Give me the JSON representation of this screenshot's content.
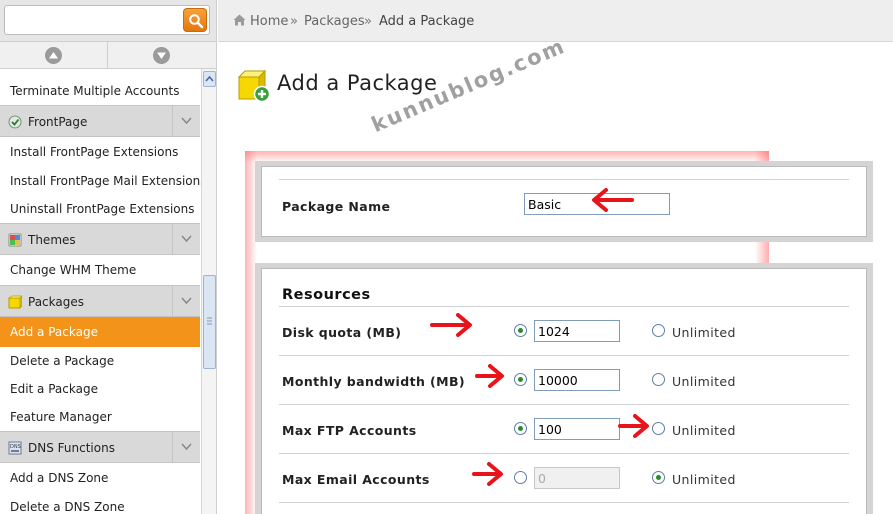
{
  "search": {
    "placeholder": "",
    "value": ""
  },
  "sidebar": {
    "items": [
      {
        "type": "item",
        "label": "Terminate Multiple Accounts"
      },
      {
        "type": "header",
        "label": "FrontPage",
        "icon": "frontpage-icon"
      },
      {
        "type": "item",
        "label": "Install FrontPage Extensions"
      },
      {
        "type": "item",
        "label": "Install FrontPage Mail Extensions"
      },
      {
        "type": "item",
        "label": "Uninstall FrontPage Extensions"
      },
      {
        "type": "header",
        "label": "Themes",
        "icon": "themes-icon"
      },
      {
        "type": "item",
        "label": "Change WHM Theme"
      },
      {
        "type": "header",
        "label": "Packages",
        "icon": "packages-icon"
      },
      {
        "type": "item",
        "label": "Add a Package",
        "active": true
      },
      {
        "type": "item",
        "label": "Delete a Package"
      },
      {
        "type": "item",
        "label": "Edit a Package"
      },
      {
        "type": "item",
        "label": "Feature Manager"
      },
      {
        "type": "header",
        "label": "DNS Functions",
        "icon": "dns-icon"
      },
      {
        "type": "item",
        "label": "Add a DNS Zone"
      },
      {
        "type": "item",
        "label": "Delete a DNS Zone"
      }
    ]
  },
  "breadcrumb": {
    "home": "Home",
    "sep": "»",
    "packages": "Packages",
    "current": "Add a Package"
  },
  "page": {
    "title": "Add a Package"
  },
  "watermark": "kunnublog.com",
  "package_name": {
    "label": "Package Name",
    "value": "Basic"
  },
  "resources": {
    "title": "Resources",
    "unlimited_label": "Unlimited",
    "rows": [
      {
        "label": "Disk quota (MB)",
        "value": "1024",
        "limited_selected": true
      },
      {
        "label": "Monthly bandwidth (MB)",
        "value": "10000",
        "limited_selected": true
      },
      {
        "label": "Max FTP Accounts",
        "value": "100",
        "limited_selected": true
      },
      {
        "label": "Max Email Accounts",
        "value": "0",
        "limited_selected": false
      }
    ]
  },
  "colors": {
    "accent": "#f39319",
    "annotation_arrow": "#e8141b",
    "radio_dot": "#2b8a2b"
  }
}
